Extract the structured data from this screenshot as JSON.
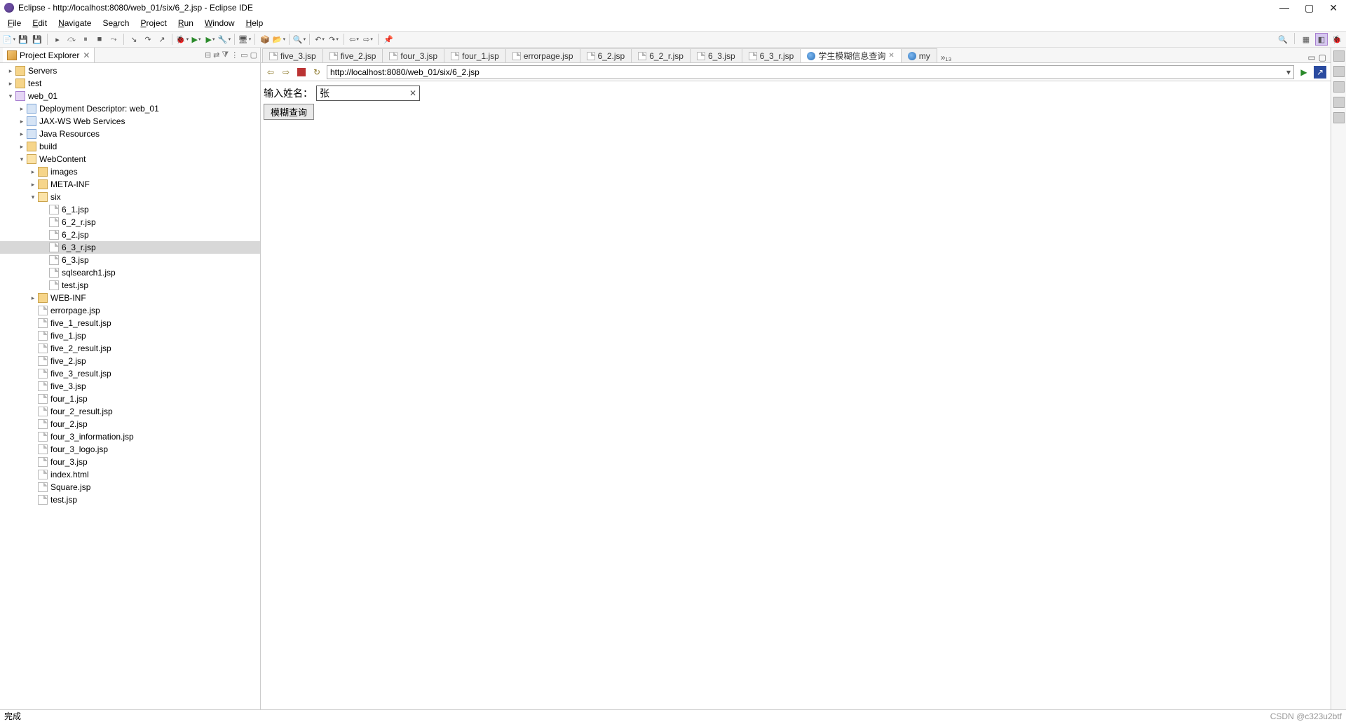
{
  "titlebar": {
    "title": "Eclipse - http://localhost:8080/web_01/six/6_2.jsp - Eclipse IDE"
  },
  "menu": [
    "File",
    "Edit",
    "Navigate",
    "Search",
    "Project",
    "Run",
    "Window",
    "Help"
  ],
  "projectExplorer": {
    "title": "Project Explorer",
    "tree": [
      {
        "label": "Servers",
        "depth": 0,
        "icon": "folder",
        "expand": ">"
      },
      {
        "label": "test",
        "depth": 0,
        "icon": "folder",
        "expand": ">"
      },
      {
        "label": "web_01",
        "depth": 0,
        "icon": "dyn",
        "expand": "v"
      },
      {
        "label": "Deployment Descriptor: web_01",
        "depth": 1,
        "icon": "project",
        "expand": ">"
      },
      {
        "label": "JAX-WS Web Services",
        "depth": 1,
        "icon": "project",
        "expand": ">"
      },
      {
        "label": "Java Resources",
        "depth": 1,
        "icon": "project",
        "expand": ">"
      },
      {
        "label": "build",
        "depth": 1,
        "icon": "folder",
        "expand": ">"
      },
      {
        "label": "WebContent",
        "depth": 1,
        "icon": "folder-open",
        "expand": "v"
      },
      {
        "label": "images",
        "depth": 2,
        "icon": "folder",
        "expand": ">"
      },
      {
        "label": "META-INF",
        "depth": 2,
        "icon": "folder",
        "expand": ">"
      },
      {
        "label": "six",
        "depth": 2,
        "icon": "folder-open",
        "expand": "v"
      },
      {
        "label": "6_1.jsp",
        "depth": 3,
        "icon": "file",
        "expand": ""
      },
      {
        "label": "6_2_r.jsp",
        "depth": 3,
        "icon": "file",
        "expand": ""
      },
      {
        "label": "6_2.jsp",
        "depth": 3,
        "icon": "file",
        "expand": ""
      },
      {
        "label": "6_3_r.jsp",
        "depth": 3,
        "icon": "file",
        "expand": "",
        "selected": true
      },
      {
        "label": "6_3.jsp",
        "depth": 3,
        "icon": "file",
        "expand": ""
      },
      {
        "label": "sqlsearch1.jsp",
        "depth": 3,
        "icon": "file",
        "expand": ""
      },
      {
        "label": "test.jsp",
        "depth": 3,
        "icon": "file",
        "expand": ""
      },
      {
        "label": "WEB-INF",
        "depth": 2,
        "icon": "folder",
        "expand": ">"
      },
      {
        "label": "errorpage.jsp",
        "depth": 2,
        "icon": "file",
        "expand": ""
      },
      {
        "label": "five_1_result.jsp",
        "depth": 2,
        "icon": "file",
        "expand": ""
      },
      {
        "label": "five_1.jsp",
        "depth": 2,
        "icon": "file",
        "expand": ""
      },
      {
        "label": "five_2_result.jsp",
        "depth": 2,
        "icon": "file",
        "expand": ""
      },
      {
        "label": "five_2.jsp",
        "depth": 2,
        "icon": "file",
        "expand": ""
      },
      {
        "label": "five_3_result.jsp",
        "depth": 2,
        "icon": "file",
        "expand": ""
      },
      {
        "label": "five_3.jsp",
        "depth": 2,
        "icon": "file",
        "expand": ""
      },
      {
        "label": "four_1.jsp",
        "depth": 2,
        "icon": "file",
        "expand": ""
      },
      {
        "label": "four_2_result.jsp",
        "depth": 2,
        "icon": "file",
        "expand": ""
      },
      {
        "label": "four_2.jsp",
        "depth": 2,
        "icon": "file",
        "expand": ""
      },
      {
        "label": "four_3_information.jsp",
        "depth": 2,
        "icon": "file",
        "expand": ""
      },
      {
        "label": "four_3_logo.jsp",
        "depth": 2,
        "icon": "file",
        "expand": ""
      },
      {
        "label": "four_3.jsp",
        "depth": 2,
        "icon": "file",
        "expand": ""
      },
      {
        "label": "index.html",
        "depth": 2,
        "icon": "file",
        "expand": ""
      },
      {
        "label": "Square.jsp",
        "depth": 2,
        "icon": "file",
        "expand": ""
      },
      {
        "label": "test.jsp",
        "depth": 2,
        "icon": "file",
        "expand": ""
      }
    ]
  },
  "editorTabs": [
    {
      "label": "five_3.jsp",
      "icon": "file"
    },
    {
      "label": "five_2.jsp",
      "icon": "file"
    },
    {
      "label": "four_3.jsp",
      "icon": "file"
    },
    {
      "label": "four_1.jsp",
      "icon": "file"
    },
    {
      "label": "errorpage.jsp",
      "icon": "file"
    },
    {
      "label": "6_2.jsp",
      "icon": "file"
    },
    {
      "label": "6_2_r.jsp",
      "icon": "file"
    },
    {
      "label": "6_3.jsp",
      "icon": "file"
    },
    {
      "label": "6_3_r.jsp",
      "icon": "file"
    },
    {
      "label": "学生模糊信息查询",
      "icon": "globe",
      "active": true,
      "closable": true
    },
    {
      "label": "my",
      "icon": "globe"
    }
  ],
  "editorOverflow": "»₁₃",
  "browser": {
    "url": "http://localhost:8080/web_01/six/6_2.jsp"
  },
  "form": {
    "label": "输入姓名：",
    "value": "张",
    "button": "模糊查询"
  },
  "status": {
    "left": "完成",
    "right": "CSDN @c323u2btf"
  }
}
